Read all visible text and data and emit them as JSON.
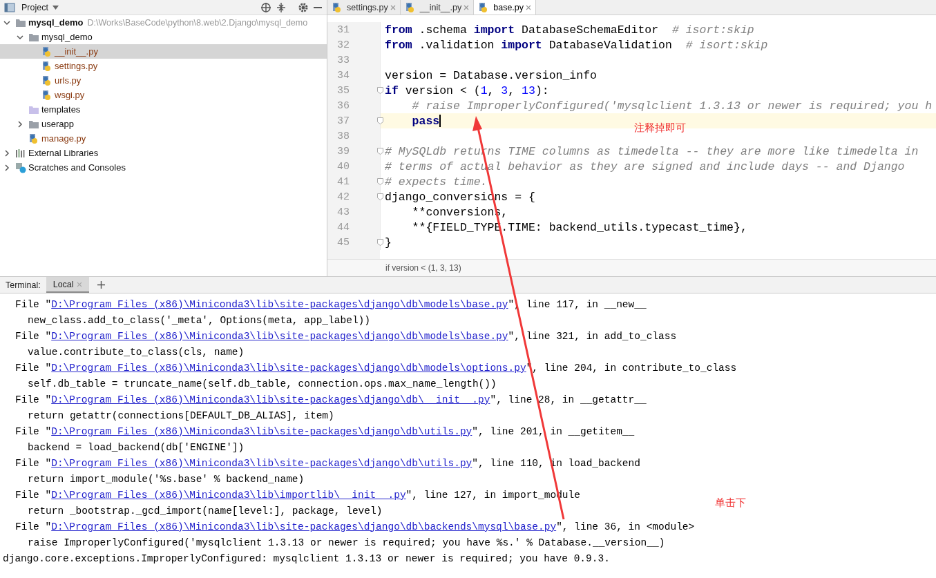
{
  "project_panel": {
    "title": "Project",
    "tree": [
      {
        "label": "mysql_demo",
        "path": "D:\\Works\\BaseCode\\python\\8.web\\2.Django\\mysql_demo",
        "kind": "root",
        "expanded": true,
        "selected": false,
        "children": [
          {
            "label": "mysql_demo",
            "kind": "folder",
            "expanded": true,
            "selected": false,
            "children": [
              {
                "label": "__init__.py",
                "kind": "py",
                "selected": true
              },
              {
                "label": "settings.py",
                "kind": "py",
                "selected": false
              },
              {
                "label": "urls.py",
                "kind": "py",
                "selected": false
              },
              {
                "label": "wsgi.py",
                "kind": "py",
                "selected": false
              }
            ]
          },
          {
            "label": "templates",
            "kind": "templates",
            "selected": false
          },
          {
            "label": "userapp",
            "kind": "folder",
            "expanded": false,
            "selected": false
          },
          {
            "label": "manage.py",
            "kind": "py",
            "selected": false
          }
        ]
      },
      {
        "label": "External Libraries",
        "kind": "libraries",
        "expanded": false,
        "selected": false
      },
      {
        "label": "Scratches and Consoles",
        "kind": "scratches",
        "expanded": false,
        "selected": false
      }
    ]
  },
  "editor": {
    "tabs": [
      {
        "label": "settings.py",
        "selected": false
      },
      {
        "label": "__init__.py",
        "selected": false
      },
      {
        "label": "base.py",
        "selected": true
      }
    ],
    "lines": [
      {
        "number": "31",
        "current": false,
        "fold": false,
        "tokens": [
          {
            "t": "from",
            "kind": "kw"
          },
          {
            "t": " .schema "
          },
          {
            "t": "import",
            "kind": "kw"
          },
          {
            "t": " DatabaseSchemaEditor  "
          },
          {
            "t": "# isort:skip",
            "kind": "comment"
          }
        ]
      },
      {
        "number": "32",
        "current": false,
        "fold": false,
        "tokens": [
          {
            "t": "from",
            "kind": "kw"
          },
          {
            "t": " .validation "
          },
          {
            "t": "import",
            "kind": "kw"
          },
          {
            "t": " DatabaseValidation  "
          },
          {
            "t": "# isort:skip",
            "kind": "comment"
          }
        ]
      },
      {
        "number": "33",
        "current": false,
        "fold": false
      },
      {
        "number": "34",
        "current": false,
        "fold": false,
        "tokens": [
          {
            "t": "version = Database.version_info"
          }
        ]
      },
      {
        "number": "35",
        "current": false,
        "fold": true,
        "tokens": [
          {
            "t": "if",
            "kind": "kw"
          },
          {
            "t": " version < ("
          },
          {
            "t": "1",
            "kind": "num"
          },
          {
            "t": ", "
          },
          {
            "t": "3",
            "kind": "num"
          },
          {
            "t": ", "
          },
          {
            "t": "13",
            "kind": "num"
          },
          {
            "t": "):"
          }
        ]
      },
      {
        "number": "36",
        "current": false,
        "fold": false,
        "tokens": [
          {
            "t": "    # raise ImproperlyConfigured('mysqlclient 1.3.13 or newer is required; you h",
            "kind": "comment"
          }
        ]
      },
      {
        "number": "37",
        "current": true,
        "fold": true,
        "tokens": [
          {
            "t": "    pass",
            "kind": "kw"
          }
        ]
      },
      {
        "number": "38",
        "current": false,
        "fold": false
      },
      {
        "number": "39",
        "current": false,
        "fold": true,
        "tokens": [
          {
            "t": "# MySQLdb returns TIME columns as timedelta -- they are more like timedelta in",
            "kind": "comment"
          }
        ]
      },
      {
        "number": "40",
        "current": false,
        "fold": false,
        "tokens": [
          {
            "t": "# terms of actual behavior as they are signed and include days -- and Django",
            "kind": "comment"
          }
        ]
      },
      {
        "number": "41",
        "current": false,
        "fold": true,
        "tokens": [
          {
            "t": "# expects time.",
            "kind": "comment"
          }
        ]
      },
      {
        "number": "42",
        "current": false,
        "fold": true,
        "tokens": [
          {
            "t": "django_conversions = {"
          }
        ]
      },
      {
        "number": "43",
        "current": false,
        "fold": false,
        "tokens": [
          {
            "t": "    **conversions,"
          }
        ]
      },
      {
        "number": "44",
        "current": false,
        "fold": false,
        "tokens": [
          {
            "t": "    **{FIELD_TYPE.TIME: backend_utils.typecast_time},"
          }
        ]
      },
      {
        "number": "45",
        "current": false,
        "fold": true,
        "tokens": [
          {
            "t": "}"
          }
        ]
      }
    ],
    "breadcrumb": "if version < (1, 3, 13)"
  },
  "terminal": {
    "label": "Terminal:",
    "tabs": [
      {
        "label": "Local",
        "selected": true
      }
    ],
    "lines": [
      {
        "kind": "file",
        "prefix": "File \"",
        "link": "D:\\Program Files (x86)\\Miniconda3\\lib\\site-packages\\django\\db\\models\\base.py",
        "suffix": "\", line 117, in __new__"
      },
      {
        "kind": "code",
        "text": "new_class.add_to_class('_meta', Options(meta, app_label))"
      },
      {
        "kind": "file",
        "prefix": "File \"",
        "link": "D:\\Program Files (x86)\\Miniconda3\\lib\\site-packages\\django\\db\\models\\base.py",
        "suffix": "\", line 321, in add_to_class"
      },
      {
        "kind": "code",
        "text": "value.contribute_to_class(cls, name)"
      },
      {
        "kind": "file",
        "prefix": "File \"",
        "link": "D:\\Program Files (x86)\\Miniconda3\\lib\\site-packages\\django\\db\\models\\options.py",
        "suffix": "\", line 204, in contribute_to_class"
      },
      {
        "kind": "code",
        "text": "self.db_table = truncate_name(self.db_table, connection.ops.max_name_length())"
      },
      {
        "kind": "file",
        "prefix": "File \"",
        "link": "D:\\Program Files (x86)\\Miniconda3\\lib\\site-packages\\django\\db\\__init__.py",
        "suffix": "\", line 28, in __getattr__"
      },
      {
        "kind": "code",
        "text": "return getattr(connections[DEFAULT_DB_ALIAS], item)"
      },
      {
        "kind": "file",
        "prefix": "File \"",
        "link": "D:\\Program Files (x86)\\Miniconda3\\lib\\site-packages\\django\\db\\utils.py",
        "suffix": "\", line 201, in __getitem__"
      },
      {
        "kind": "code",
        "text": "backend = load_backend(db['ENGINE'])"
      },
      {
        "kind": "file",
        "prefix": "File \"",
        "link": "D:\\Program Files (x86)\\Miniconda3\\lib\\site-packages\\django\\db\\utils.py",
        "suffix": "\", line 110, in load_backend"
      },
      {
        "kind": "code",
        "text": "return import_module('%s.base' % backend_name)"
      },
      {
        "kind": "file",
        "prefix": "File \"",
        "link": "D:\\Program Files (x86)\\Miniconda3\\lib\\importlib\\__init__.py",
        "suffix": "\", line 127, in import_module"
      },
      {
        "kind": "code",
        "text": "return _bootstrap._gcd_import(name[level:], package, level)"
      },
      {
        "kind": "file",
        "prefix": "File \"",
        "link": "D:\\Program Files (x86)\\Miniconda3\\lib\\site-packages\\django\\db\\backends\\mysql\\base.py",
        "suffix": "\", line 36, in <module>"
      },
      {
        "kind": "code",
        "text": "raise ImproperlyConfigured('mysqlclient 1.3.13 or newer is required; you have %s.' % Database.__version__)"
      },
      {
        "kind": "error",
        "text": "django.core.exceptions.ImproperlyConfigured: mysqlclient 1.3.13 or newer is required; you have 0.9.3."
      }
    ]
  },
  "annotations": [
    {
      "text": "注释掉即可"
    },
    {
      "text": "单击下"
    }
  ]
}
